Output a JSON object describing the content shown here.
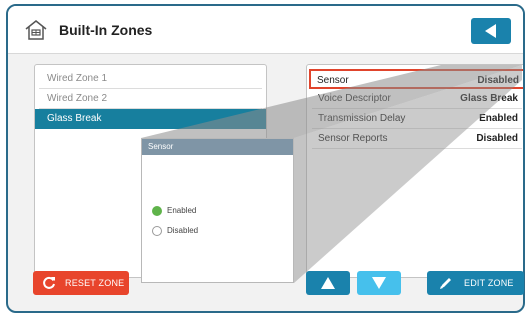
{
  "header": {
    "title": "Built-In Zones",
    "home_icon": "home-icon",
    "back_icon": "back-arrow-icon",
    "accent_color": "#1a82ac"
  },
  "zones": [
    {
      "label": "Wired Zone 1",
      "selected": false
    },
    {
      "label": "Wired Zone 2",
      "selected": false
    },
    {
      "label": "Glass Break",
      "selected": true
    }
  ],
  "properties": [
    {
      "label": "Sensor",
      "value": "Disabled",
      "highlighted": true
    },
    {
      "label": "Voice Descriptor",
      "value": "Glass Break",
      "highlighted": false
    },
    {
      "label": "Transmission Delay",
      "value": "Enabled",
      "highlighted": false
    },
    {
      "label": "Sensor Reports",
      "value": "Disabled",
      "highlighted": false
    }
  ],
  "popup": {
    "title": "Sensor",
    "options": [
      {
        "label": "Enabled",
        "selected": true
      },
      {
        "label": "Disabled",
        "selected": false
      }
    ]
  },
  "buttons": {
    "reset_label": "RESET ZONE",
    "reset_icon": "reset-icon",
    "up_icon": "arrow-up-icon",
    "down_icon": "arrow-down-icon",
    "edit_label": "EDIT ZONE",
    "edit_icon": "pencil-icon",
    "reset_color": "#e8452c",
    "down_color": "#46c0ec"
  }
}
